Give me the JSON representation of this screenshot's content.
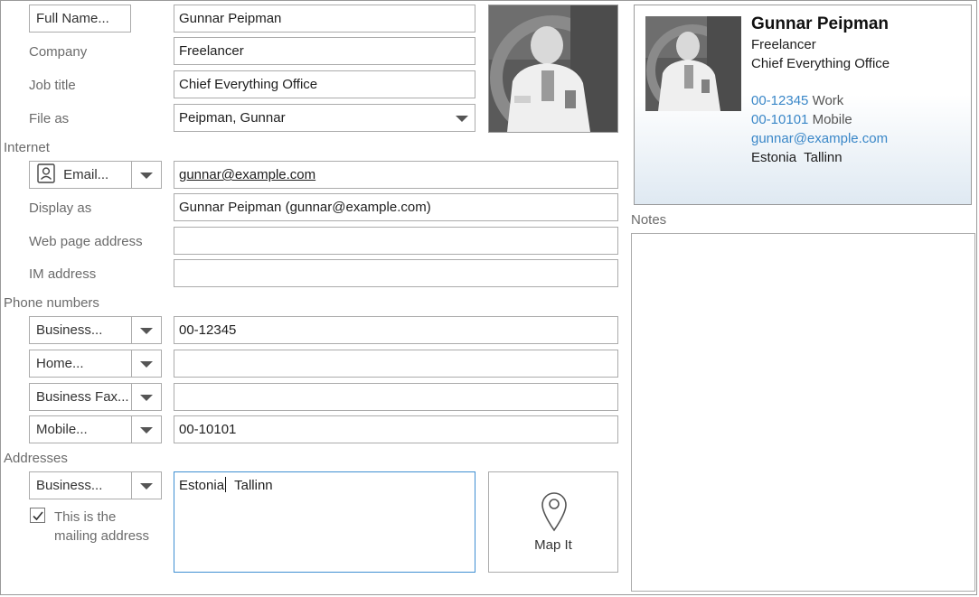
{
  "form": {
    "full_name_button": "Full Name...",
    "full_name": "Gunnar Peipman",
    "company_label": "Company",
    "company": "Freelancer",
    "job_title_label": "Job title",
    "job_title": "Chief Everything Office",
    "file_as_label": "File as",
    "file_as": "Peipman, Gunnar"
  },
  "internet": {
    "section_label": "Internet",
    "email_button": "Email...",
    "email": "gunnar@example.com",
    "display_as_label": "Display as",
    "display_as": "Gunnar Peipman (gunnar@example.com)",
    "web_page_label": "Web page address",
    "web_page": "",
    "im_label": "IM address",
    "im": ""
  },
  "phones": {
    "section_label": "Phone numbers",
    "rows": [
      {
        "type": "Business...",
        "value": "00-12345"
      },
      {
        "type": "Home...",
        "value": ""
      },
      {
        "type": "Business Fax...",
        "value": ""
      },
      {
        "type": "Mobile...",
        "value": "00-10101"
      }
    ]
  },
  "addresses": {
    "section_label": "Addresses",
    "type": "Business...",
    "address_before_caret": "Estonia",
    "address_after_caret": "  Tallinn",
    "mailing_checkbox_label_line1": "This is the",
    "mailing_checkbox_label_line2": "mailing address",
    "mailing_checked": true,
    "map_button": "Map It"
  },
  "card": {
    "name": "Gunnar Peipman",
    "company": "Freelancer",
    "job_title": "Chief Everything Office",
    "phone1": "00-12345",
    "phone1_type": "Work",
    "phone2": "00-10101",
    "phone2_type": "Mobile",
    "email": "gunnar@example.com",
    "address": "Estonia  Tallinn"
  },
  "notes": {
    "label": "Notes",
    "value": ""
  },
  "icons": {
    "contact_card": "person-card-icon",
    "dropdown": "chevron-down-icon",
    "map_pin": "map-pin-icon",
    "check": "check-icon"
  },
  "colors": {
    "link": "#3a87c8",
    "border": "#ababab",
    "focus_border": "#3f8fd2",
    "label": "#6b6b6b"
  }
}
